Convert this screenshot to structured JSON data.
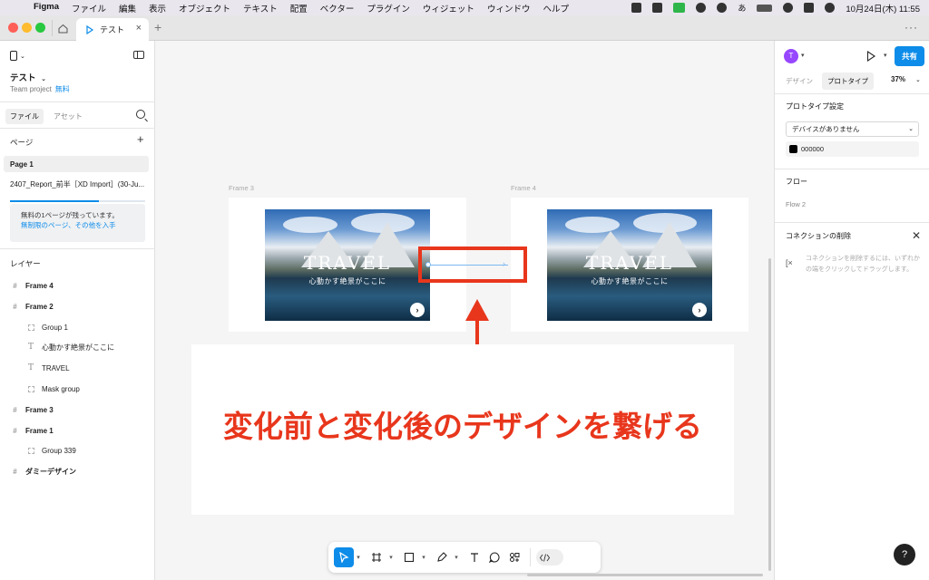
{
  "menubar": {
    "app": "Figma",
    "items": [
      "ファイル",
      "編集",
      "表示",
      "オブジェクト",
      "テキスト",
      "配置",
      "ベクター",
      "プラグイン",
      "ウィジェット",
      "ウィンドウ",
      "ヘルプ"
    ],
    "clock": "10月24日(木)  11:55",
    "ime": "あ"
  },
  "tabs": {
    "file_tab": "テスト"
  },
  "left_panel": {
    "file_name": "テスト",
    "team": "Team project",
    "plan": "無料",
    "tab_file": "ファイル",
    "tab_assets": "アセット",
    "pages_heading": "ページ",
    "pages": [
      "Page 1",
      "2407_Report_前半［XD Import］(30-Ju..."
    ],
    "upsell_text": "無料の1ページが残っています。",
    "upsell_link": "無制限のページ、その他を入手",
    "layers_heading": "レイヤー",
    "layers": [
      {
        "name": "Frame 4",
        "level": 0,
        "kind": "frame"
      },
      {
        "name": "Frame 2",
        "level": 0,
        "kind": "frame"
      },
      {
        "name": "Group 1",
        "level": 1,
        "kind": "group"
      },
      {
        "name": "心動かす絶景がここに",
        "level": 1,
        "kind": "text"
      },
      {
        "name": "TRAVEL",
        "level": 1,
        "kind": "text"
      },
      {
        "name": "Mask group",
        "level": 1,
        "kind": "group"
      },
      {
        "name": "Frame 3",
        "level": 0,
        "kind": "frame"
      },
      {
        "name": "Frame 1",
        "level": 0,
        "kind": "frame"
      },
      {
        "name": "Group 339",
        "level": 1,
        "kind": "group"
      },
      {
        "name": "ダミーデザイン",
        "level": 0,
        "kind": "frame"
      }
    ]
  },
  "canvas": {
    "frame3_label": "Frame 3",
    "frame4_label": "Frame 4",
    "hero_title": "TRAVEL",
    "hero_subtitle": "心動かす絶景がここに",
    "next_glyph": "›",
    "annotation": "変化前と変化後のデザインを繋げる"
  },
  "toolbar": {
    "tools": [
      "move-tool",
      "frame-tool",
      "shape-tool",
      "pen-tool",
      "text-tool",
      "comment-tool",
      "actions-tool",
      "dev-mode-toggle"
    ]
  },
  "right_panel": {
    "avatar_initial": "T",
    "share_label": "共有",
    "tab_design": "デザイン",
    "tab_prototype": "プロトタイプ",
    "zoom": "37%",
    "proto_settings_heading": "プロトタイプ設定",
    "device_select": "デバイスがありません",
    "bg_color": "000000",
    "flow_heading": "フロー",
    "flow_item": "Flow 2",
    "delete_conn_heading": "コネクションの削除",
    "delete_conn_help": "コネクションを削除するには、いずれかの端をクリックしてドラッグします。",
    "help": "?"
  },
  "colors": {
    "accent": "#0d8ce9",
    "annotation_red": "#e8361c",
    "connection_blue": "#7ab8f0"
  }
}
